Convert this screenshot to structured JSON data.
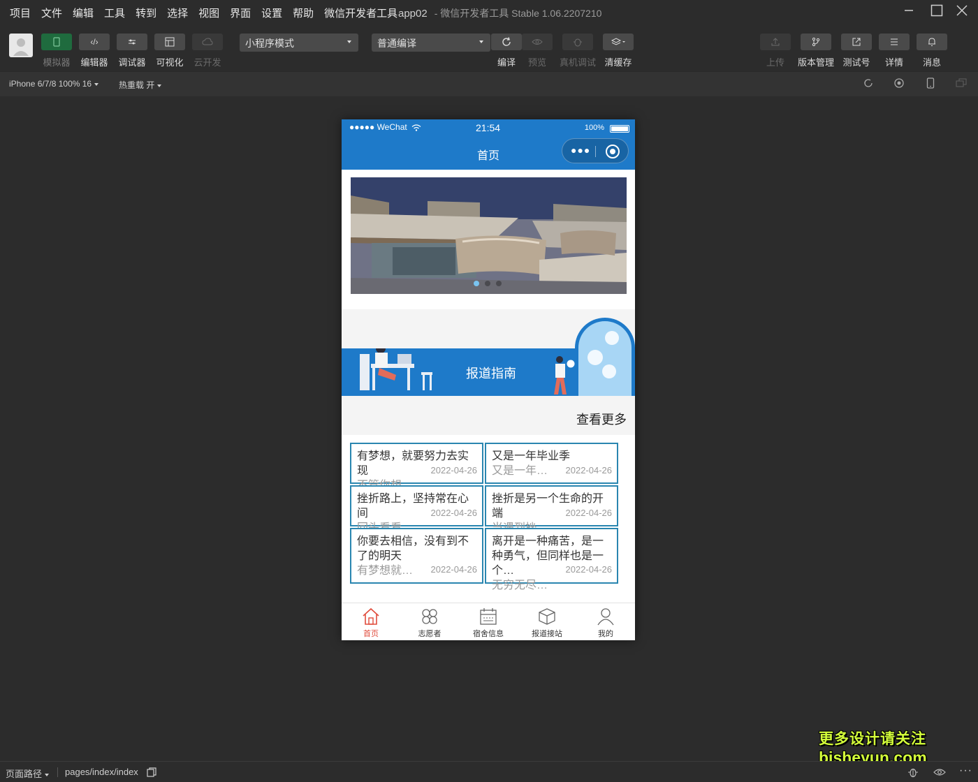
{
  "menubar": {
    "items": [
      "项目",
      "文件",
      "编辑",
      "工具",
      "转到",
      "选择",
      "视图",
      "界面",
      "设置",
      "帮助",
      "微信开发者工具"
    ],
    "app_name": "app02",
    "title": "- 微信开发者工具 Stable 1.06.2207210"
  },
  "toolbar": {
    "simulator": "模拟器",
    "editor": "编辑器",
    "debugger": "调试器",
    "visual": "可视化",
    "cloud": "云开发",
    "mode_select": "小程序模式",
    "compile_select": "普通编译",
    "compile": "编译",
    "preview": "预览",
    "real_debug": "真机调试",
    "clear_cache": "清缓存",
    "upload": "上传",
    "version": "版本管理",
    "test_account": "测试号",
    "details": "详情",
    "messages": "消息"
  },
  "subbar": {
    "device": "iPhone 6/7/8 100% 16",
    "hot_reload": "热重载 开"
  },
  "phone": {
    "status": {
      "carrier": "●●●●● WeChat",
      "time": "21:54",
      "battery": "100%"
    },
    "nav_title": "首页",
    "guide_title": "报道指南",
    "more": "查看更多",
    "cards": [
      {
        "title": "有梦想，就要努力去实现",
        "summary": "不管你想…",
        "date": "2022-04-26"
      },
      {
        "title": "又是一年毕业季",
        "summary": "又是一年…",
        "date": "2022-04-26"
      },
      {
        "title": "挫折路上，坚持常在心间",
        "summary": "回头看看…",
        "date": "2022-04-26"
      },
      {
        "title": "挫折是另一个生命的开端",
        "summary": "当遇到挫…",
        "date": "2022-04-26"
      },
      {
        "title": "你要去相信，没有到不了的明天",
        "summary": "有梦想就…",
        "date": "2022-04-26"
      },
      {
        "title": "离开是一种痛苦，是一种勇气，但同样也是一个…",
        "summary": "无穷无尽…",
        "date": "2022-04-26"
      }
    ],
    "tabs": [
      {
        "label": "首页",
        "icon": "home-icon",
        "active": true
      },
      {
        "label": "志愿者",
        "icon": "clover-icon",
        "active": false
      },
      {
        "label": "宿舍信息",
        "icon": "calendar-icon",
        "active": false
      },
      {
        "label": "报道接站",
        "icon": "box-icon",
        "active": false
      },
      {
        "label": "我的",
        "icon": "user-icon",
        "active": false
      }
    ],
    "accent_color": "#1e7ac9",
    "active_tab_color": "#e04b3b"
  },
  "statusbar": {
    "page_path_label": "页面路径",
    "page_path": "pages/index/index"
  },
  "watermark": {
    "line1": "更多设计请关注",
    "line2": "bisheyun.com"
  }
}
